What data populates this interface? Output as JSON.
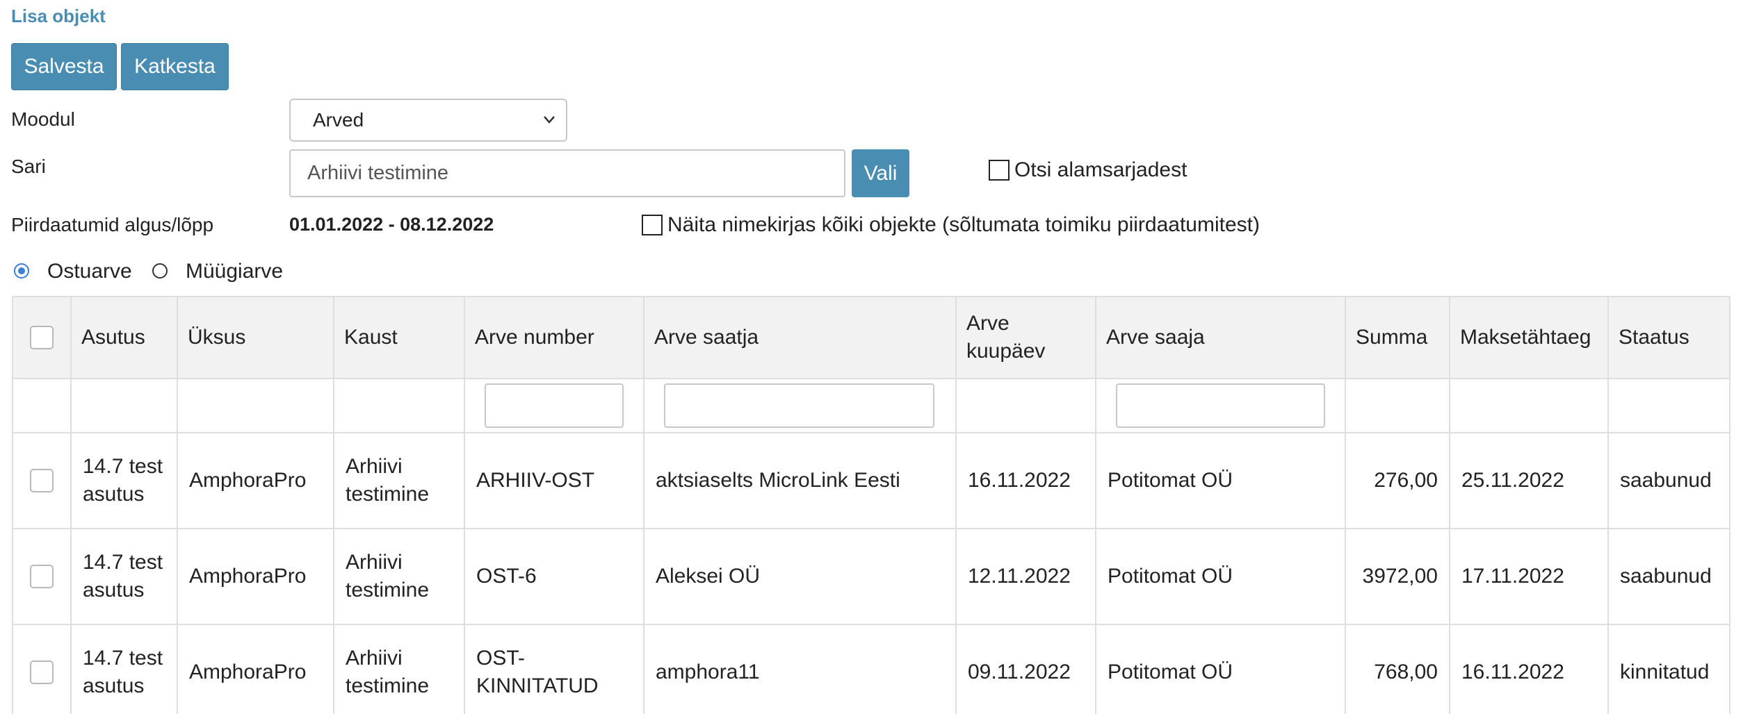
{
  "title": "Lisa objekt",
  "toolbar": {
    "save_label": "Salvesta",
    "cancel_label": "Katkesta"
  },
  "form": {
    "module_label": "Moodul",
    "module_value": "Arved",
    "series_label": "Sari",
    "series_value": "Arhiivi testimine",
    "choose_label": "Vali",
    "search_subseries_label": "Otsi alamsarjadest",
    "limit_dates_label": "Piirdaatumid algus/lõpp",
    "limit_dates_value": "01.01.2022 - 08.12.2022",
    "show_all_label": "Näita nimekirjas kõiki objekte (sõltumata toimiku piirdaatumitest)",
    "radio_purchase": "Ostuarve",
    "radio_sales": "Müügiarve"
  },
  "table": {
    "headers": [
      "Asutus",
      "Üksus",
      "Kaust",
      "Arve number",
      "Arve saatja",
      "Arve kuupäev",
      "Arve saaja",
      "Summa",
      "Maksetähtaeg",
      "Staatus"
    ],
    "rows": [
      [
        "14.7 test asutus",
        "AmphoraPro",
        "Arhiivi testimine",
        "ARHIIV-OST",
        "aktsiaselts MicroLink Eesti",
        "16.11.2022",
        "Potitomat OÜ",
        "276,00",
        "25.11.2022",
        "saabunud"
      ],
      [
        "14.7 test asutus",
        "AmphoraPro",
        "Arhiivi testimine",
        "OST-6",
        "Aleksei OÜ",
        "12.11.2022",
        "Potitomat OÜ",
        "3972,00",
        "17.11.2022",
        "saabunud"
      ],
      [
        "14.7 test asutus",
        "AmphoraPro",
        "Arhiivi testimine",
        "OST-KINNITATUD",
        "amphora11",
        "09.11.2022",
        "Potitomat OÜ",
        "768,00",
        "16.11.2022",
        "kinnitatud"
      ]
    ]
  },
  "colors": {
    "accent": "#4a8db3",
    "header_bg": "#f2f2f2",
    "border": "#dedede"
  }
}
